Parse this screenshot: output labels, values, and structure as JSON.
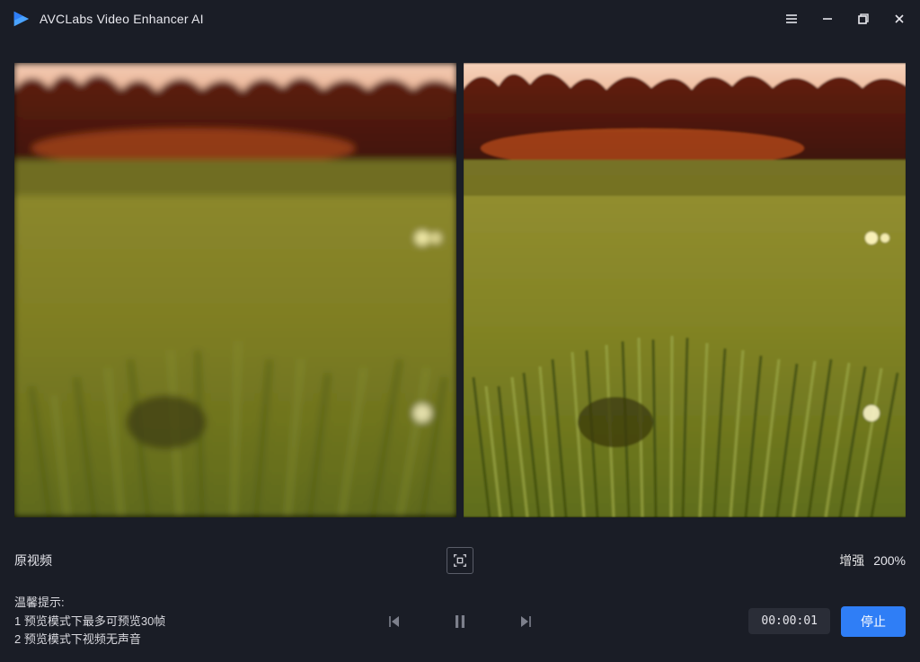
{
  "app": {
    "title": "AVCLabs Video Enhancer AI"
  },
  "labels": {
    "original": "原视频",
    "enhanced": "增强",
    "zoom": "200%"
  },
  "hints": {
    "title": "温馨提示:",
    "line1": "1 预览模式下最多可预览30帧",
    "line2": "2 预览模式下视频无声音"
  },
  "playback": {
    "timecode": "00:00:01",
    "stop_label": "停止"
  }
}
